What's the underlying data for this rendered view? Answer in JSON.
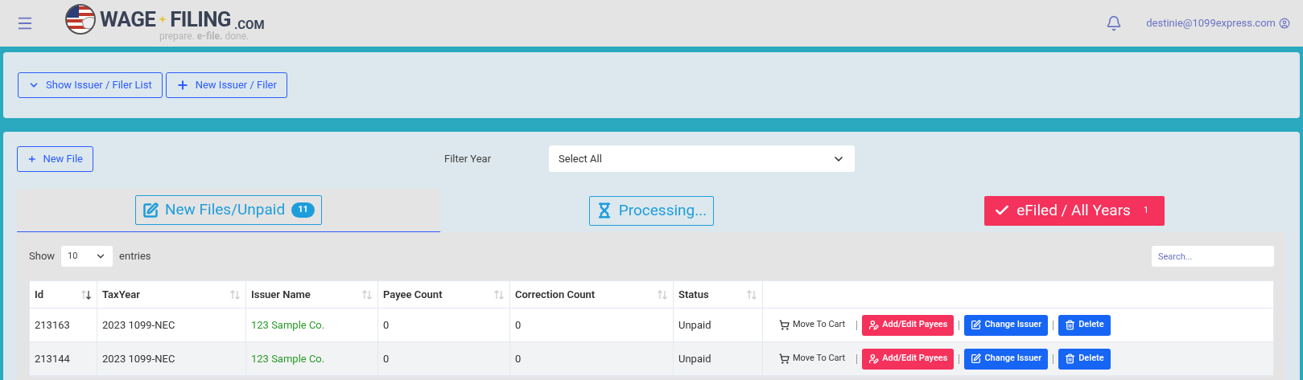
{
  "header": {
    "logo": {
      "word_1": "WAGE",
      "word_2": "FILING",
      "suffix": ".COM",
      "tagline": "prepare. **e-file.** done."
    },
    "user_email": "destinie@1099express.com"
  },
  "issuer_panel": {
    "buttons": [
      {
        "label": "Show Issuer / Filer List",
        "kind": "toggle"
      },
      {
        "label": "New Issuer / Filer",
        "kind": "add"
      }
    ]
  },
  "files_panel": {
    "new_file_button": "New File",
    "filter": {
      "label": "Filter Year",
      "value": "Select All"
    },
    "tabs": [
      {
        "label": "New Files/Unpaid",
        "count": "11",
        "kind": "unpaid",
        "selected": true
      },
      {
        "label": "Processing...",
        "kind": "processing",
        "selected": false
      },
      {
        "label": "eFiled / All Years",
        "count": "1",
        "kind": "efiled",
        "selected": false
      }
    ],
    "table": {
      "length_label_before": "Show",
      "length_value": "10",
      "length_label_after": "entries",
      "search_placeholder": "Search...",
      "columns": [
        {
          "label": "Id",
          "sorted": true
        },
        {
          "label": "TaxYear",
          "sorted": false
        },
        {
          "label": "Issuer Name",
          "sorted": false
        },
        {
          "label": "Payee Count",
          "sorted": false
        },
        {
          "label": "Correction Count",
          "sorted": false
        },
        {
          "label": "Status",
          "sorted": false
        }
      ],
      "rows": [
        {
          "id": "213163",
          "tax_year": "2023 1099-NEC",
          "issuer_name": "123 Sample Co.",
          "payee_count": "0",
          "correction_count": "0",
          "status": "Unpaid",
          "actions": [
            {
              "label": "Move To Cart",
              "kind": "cart"
            },
            {
              "label": "Add/Edit Payees",
              "kind": "payees"
            },
            {
              "label": "Change Issuer",
              "kind": "change"
            },
            {
              "label": "Delete",
              "kind": "delete"
            }
          ]
        },
        {
          "id": "213144",
          "tax_year": "2023 1099-NEC",
          "issuer_name": "123 Sample Co.",
          "payee_count": "0",
          "correction_count": "0",
          "status": "Unpaid",
          "actions": [
            {
              "label": "Move To Cart",
              "kind": "cart"
            },
            {
              "label": "Add/Edit Payees",
              "kind": "payees"
            },
            {
              "label": "Change Issuer",
              "kind": "change"
            },
            {
              "label": "Delete",
              "kind": "delete"
            }
          ]
        }
      ]
    }
  }
}
